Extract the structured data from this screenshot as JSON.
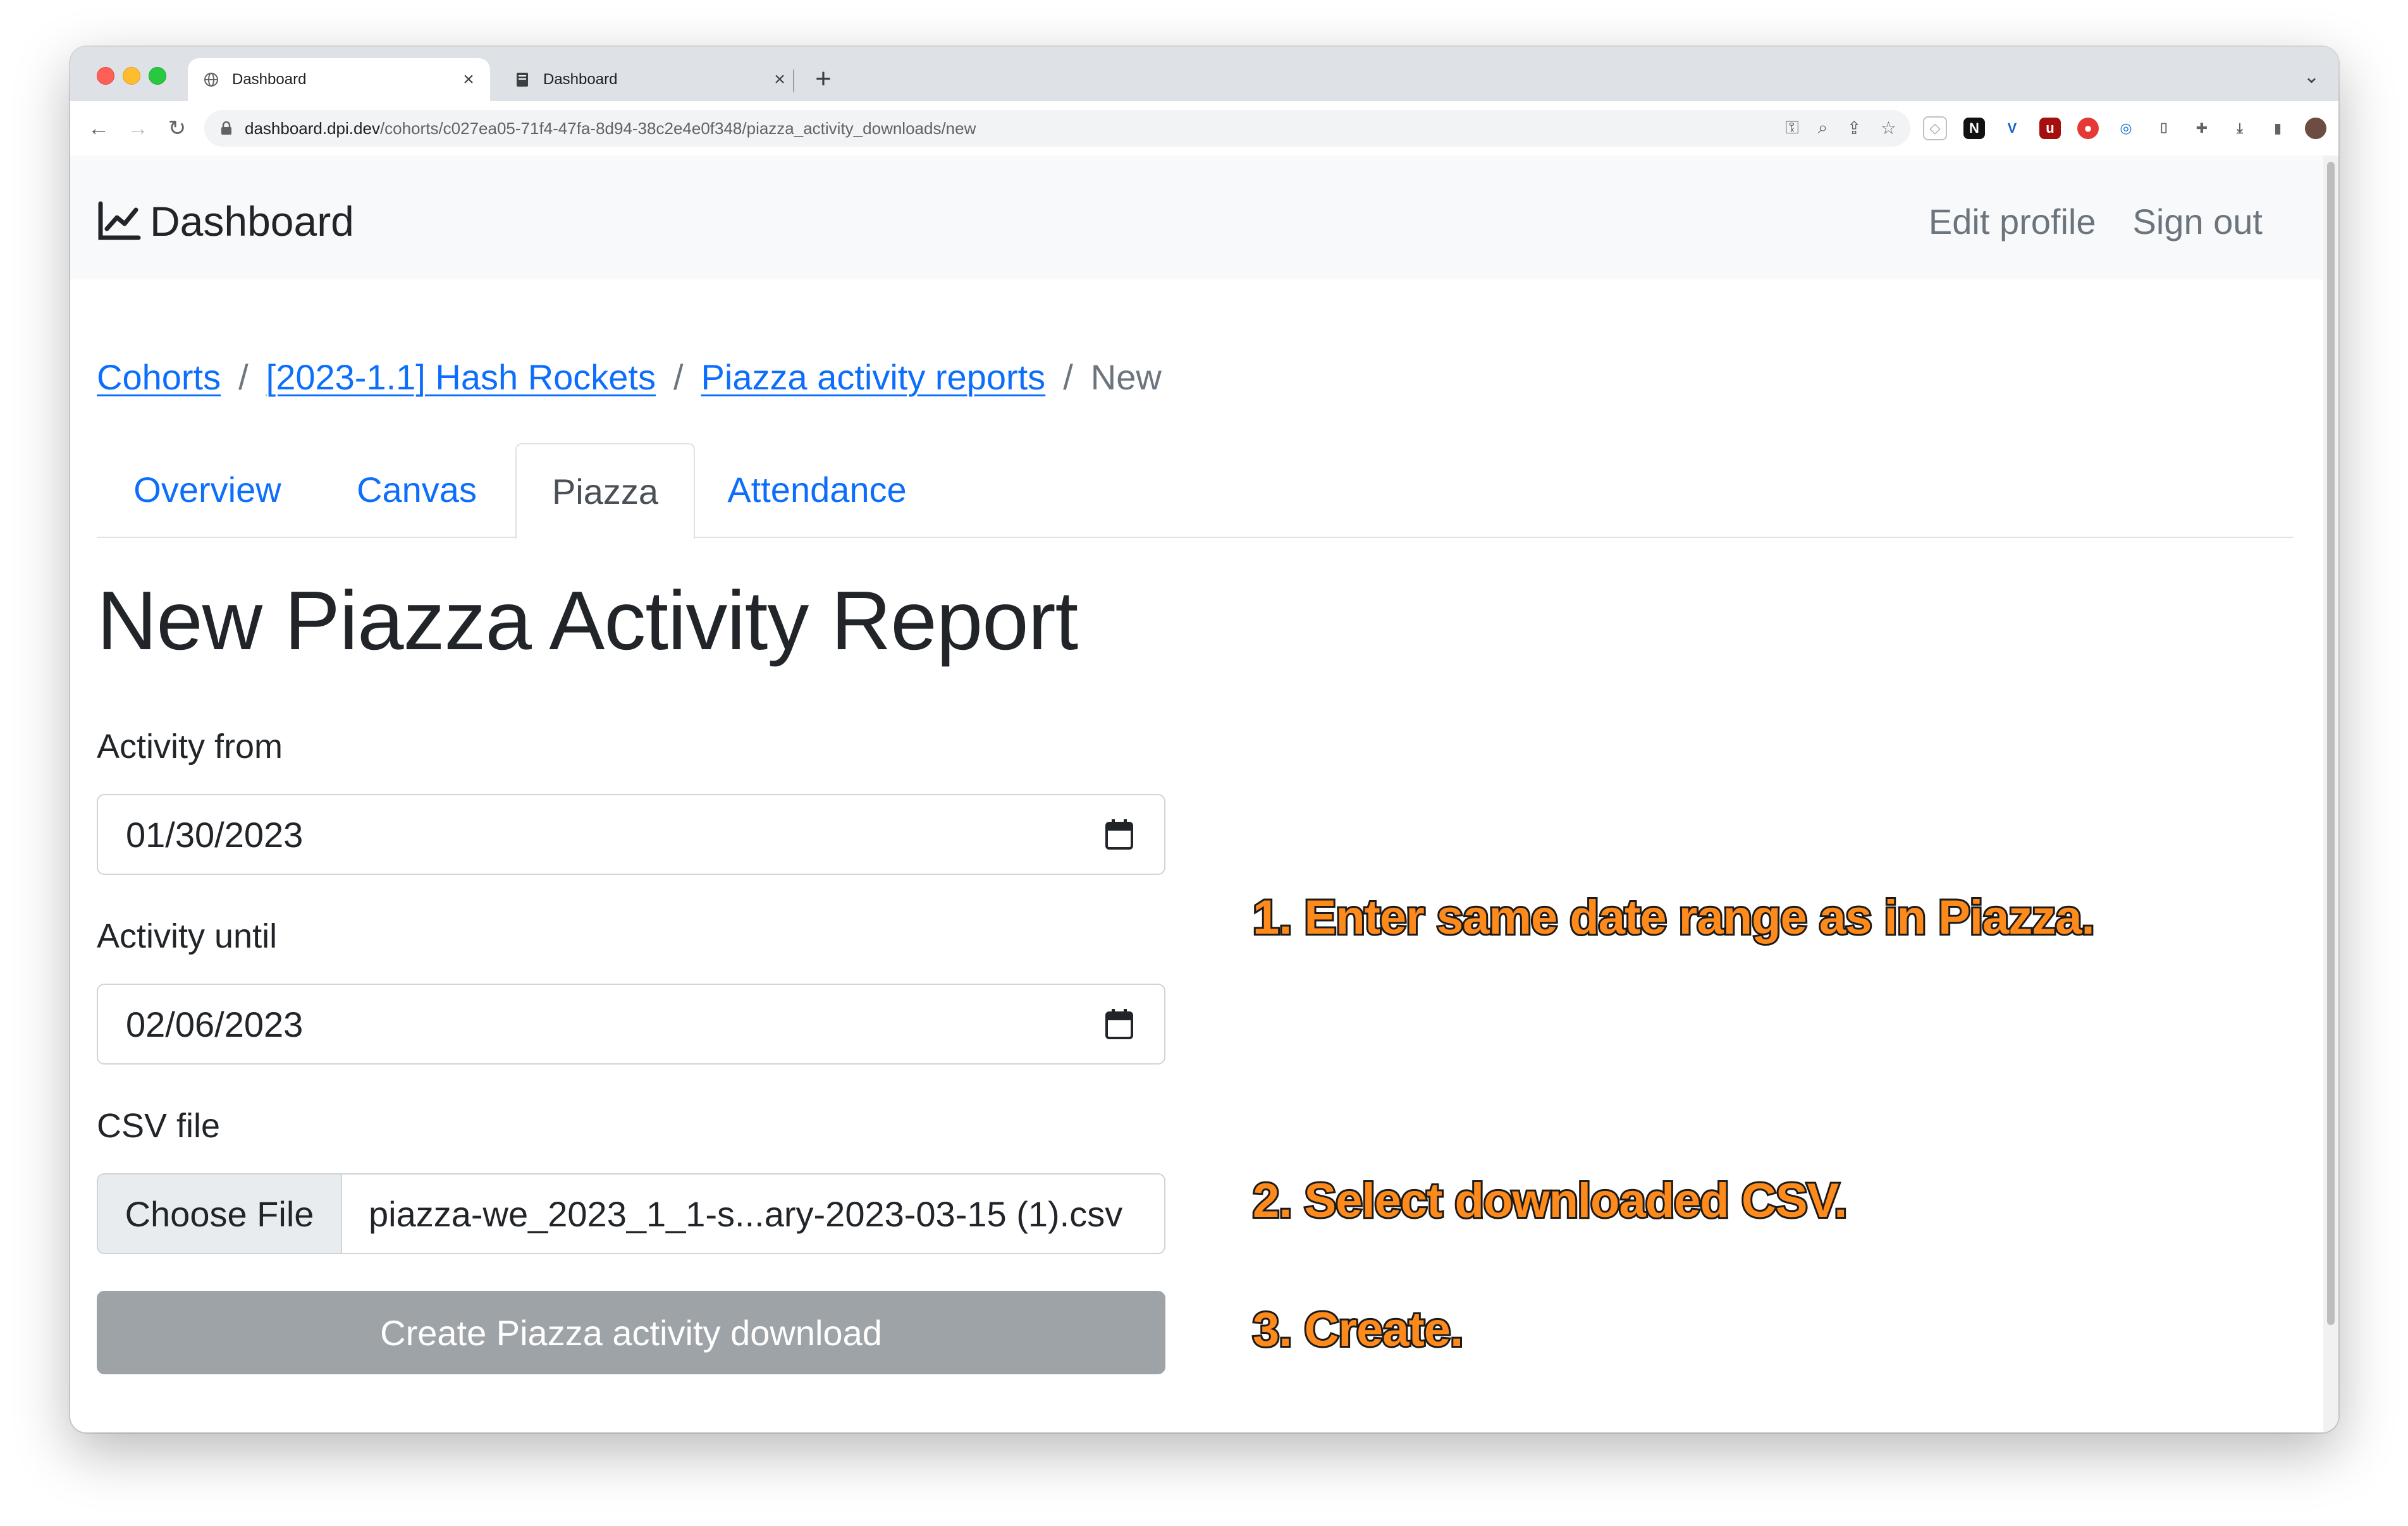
{
  "browser": {
    "tabs": [
      {
        "title": "Dashboard",
        "active": true
      },
      {
        "title": "Dashboard",
        "active": false
      }
    ],
    "url_host": "dashboard.dpi.dev",
    "url_path": "/cohorts/c027ea05-71f4-47fa-8d94-38c2e4e0f348/piazza_activity_downloads/new",
    "accent_color": "#1a73e8"
  },
  "navbar": {
    "brand": "Dashboard",
    "links": {
      "edit_profile": "Edit profile",
      "sign_out": "Sign out"
    }
  },
  "breadcrumb": {
    "items": [
      "Cohorts",
      "[2023-1.1] Hash Rockets",
      "Piazza activity reports"
    ],
    "separator": "/",
    "current": "New"
  },
  "tabs": {
    "items": [
      "Overview",
      "Canvas",
      "Piazza",
      "Attendance"
    ],
    "active": "Piazza"
  },
  "page": {
    "title": "New Piazza Activity Report"
  },
  "form": {
    "activity_from": {
      "label": "Activity from",
      "value": "01/30/2023"
    },
    "activity_until": {
      "label": "Activity until",
      "value": "02/06/2023"
    },
    "csv_file": {
      "label": "CSV file",
      "button": "Choose File",
      "filename": "piazza-we_2023_1_1-s...ary-2023-03-15 (1).csv"
    },
    "submit": "Create Piazza activity download"
  },
  "annotations": {
    "step1": "1. Enter same date range as in Piazza.",
    "step2": "2. Select downloaded CSV.",
    "step3": "3. Create."
  },
  "colors": {
    "link": "#0d6efd",
    "button_disabled": "#9ea3a8",
    "annotation_fill": "#ff8a1c",
    "annotation_stroke": "#1a1a1a"
  }
}
